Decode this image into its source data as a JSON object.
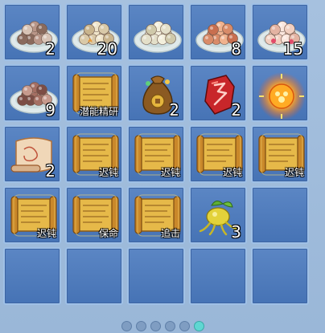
{
  "inventory": {
    "rows": [
      [
        {
          "icon": "dumpling-plate-icon",
          "count": "2",
          "label": ""
        },
        {
          "icon": "dumpling-plate-icon",
          "count": "20",
          "label": ""
        },
        {
          "icon": "dumpling-plate-icon",
          "count": "",
          "label": ""
        },
        {
          "icon": "dumpling-plate-icon",
          "count": "8",
          "label": ""
        },
        {
          "icon": "dumpling-plate-icon",
          "count": "15",
          "label": ""
        }
      ],
      [
        {
          "icon": "dumpling-plate-icon",
          "count": "9",
          "label": ""
        },
        {
          "icon": "scroll-icon",
          "count": "",
          "label": "潜能精研"
        },
        {
          "icon": "money-bag-icon",
          "count": "2",
          "label": ""
        },
        {
          "icon": "red-crystal-icon",
          "count": "2",
          "label": ""
        },
        {
          "icon": "glowing-orb-icon",
          "count": "",
          "label": ""
        }
      ],
      [
        {
          "icon": "map-scroll-icon",
          "count": "2",
          "label": ""
        },
        {
          "icon": "scroll-icon",
          "count": "",
          "label": "迟钝"
        },
        {
          "icon": "scroll-icon",
          "count": "",
          "label": "迟钝"
        },
        {
          "icon": "scroll-icon",
          "count": "",
          "label": "迟钝"
        },
        {
          "icon": "scroll-icon",
          "count": "",
          "label": "迟钝"
        }
      ],
      [
        {
          "icon": "scroll-icon",
          "count": "",
          "label": "迟钝"
        },
        {
          "icon": "scroll-icon",
          "count": "",
          "label": "保命"
        },
        {
          "icon": "scroll-icon",
          "count": "",
          "label": "追击"
        },
        {
          "icon": "golden-fruit-icon",
          "count": "3",
          "label": ""
        },
        {
          "icon": "",
          "count": "",
          "label": ""
        }
      ],
      [
        {
          "icon": "",
          "count": "",
          "label": ""
        },
        {
          "icon": "",
          "count": "",
          "label": ""
        },
        {
          "icon": "",
          "count": "",
          "label": ""
        },
        {
          "icon": "",
          "count": "",
          "label": ""
        },
        {
          "icon": "",
          "count": "",
          "label": ""
        }
      ]
    ]
  },
  "pager": {
    "pages": 6,
    "active": 5
  },
  "colors": {
    "slot_fill": "#4f7dbf",
    "slot_border": "#9fc0e6",
    "pager_active": "#5fd7d2",
    "pager_inactive": "#7f9dc2"
  }
}
